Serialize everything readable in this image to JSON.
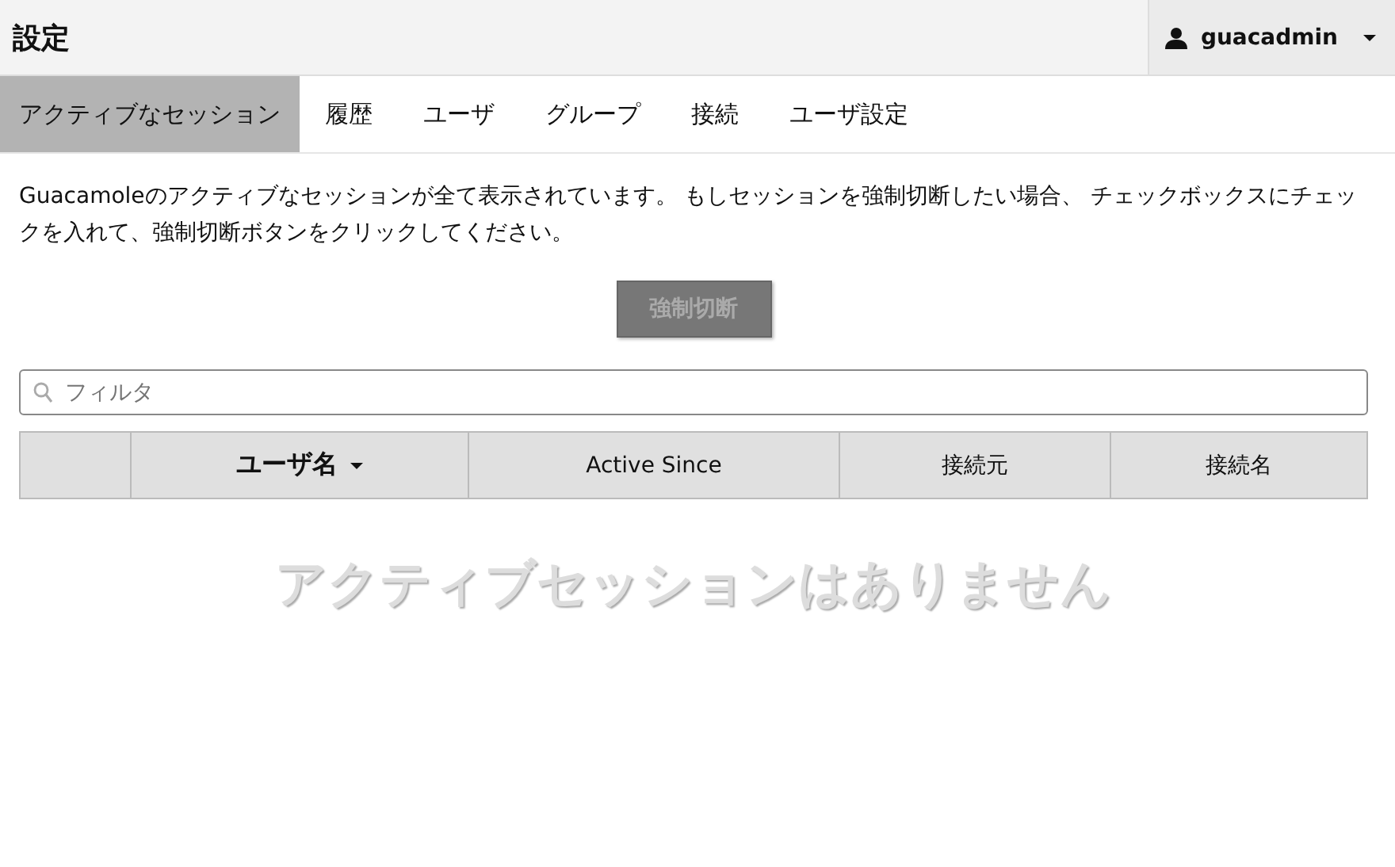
{
  "header": {
    "title": "設定",
    "user": "guacadmin"
  },
  "tabs": [
    {
      "label": "アクティブなセッション",
      "selected": true
    },
    {
      "label": "履歴",
      "selected": false
    },
    {
      "label": "ユーザ",
      "selected": false
    },
    {
      "label": "グループ",
      "selected": false
    },
    {
      "label": "接続",
      "selected": false
    },
    {
      "label": "ユーザ設定",
      "selected": false
    }
  ],
  "description": "Guacamoleのアクティブなセッションが全て表示されています。 もしセッションを強制切断したい場合、 チェックボックスにチェックを入れて、強制切断ボタンをクリックしてください。",
  "kill_button": {
    "label": "強制切断",
    "disabled": true
  },
  "filter": {
    "placeholder": "フィルタ"
  },
  "table": {
    "columns": [
      {
        "label": "ユーザ名",
        "sorted": true
      },
      {
        "label": "Active Since",
        "sorted": false
      },
      {
        "label": "接続元",
        "sorted": false
      },
      {
        "label": "接続名",
        "sorted": false
      }
    ]
  },
  "empty_message": "アクティブセッションはありません"
}
